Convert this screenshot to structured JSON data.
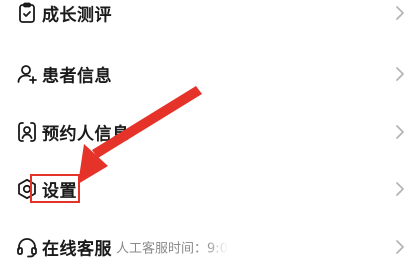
{
  "menu": {
    "items": [
      {
        "label": "成长测评",
        "icon": "clipboard-icon"
      },
      {
        "label": "患者信息",
        "icon": "user-icon"
      },
      {
        "label": "预约人信息",
        "icon": "id-card-icon"
      },
      {
        "label": "设置",
        "icon": "gear-icon"
      },
      {
        "label": "在线客服",
        "icon": "headset-icon",
        "note": "人工客服时间：9:0"
      }
    ]
  },
  "annotation": {
    "arrow_color": "#e6332a",
    "highlight_color": "#e6332a"
  }
}
